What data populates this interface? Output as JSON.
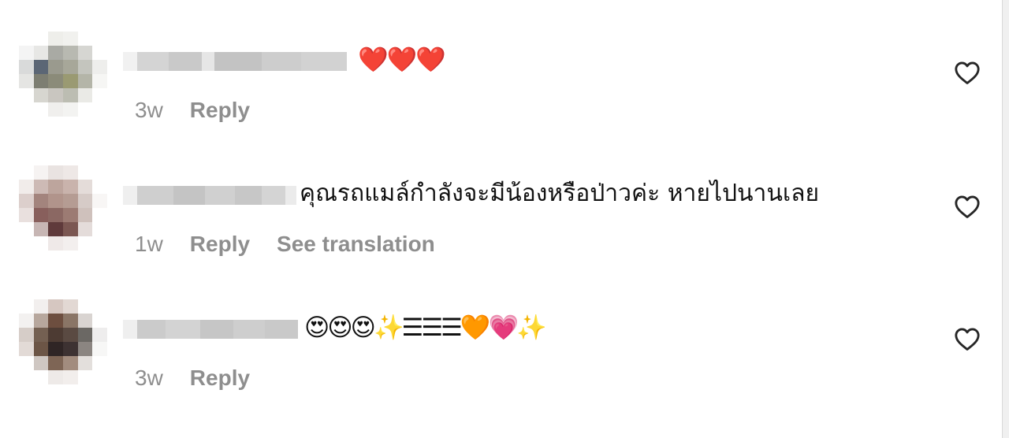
{
  "comments": [
    {
      "time": "3w",
      "reply_label": "Reply",
      "text": "❤️❤️❤️"
    },
    {
      "time": "1w",
      "reply_label": "Reply",
      "translate_label": "See translation",
      "text": "คุณรถแมล์กำลังจะมีน้องหรือป่าวค่ะ หายไปนานเลย"
    },
    {
      "time": "3w",
      "reply_label": "Reply",
      "text": "😍😍😍✨☰☰☰🧡💗✨"
    }
  ],
  "icons": {
    "like": "heart-outline-icon"
  },
  "colors": {
    "meta_text": "#8e8e8e",
    "comment_text": "#111111",
    "background": "#ffffff"
  }
}
